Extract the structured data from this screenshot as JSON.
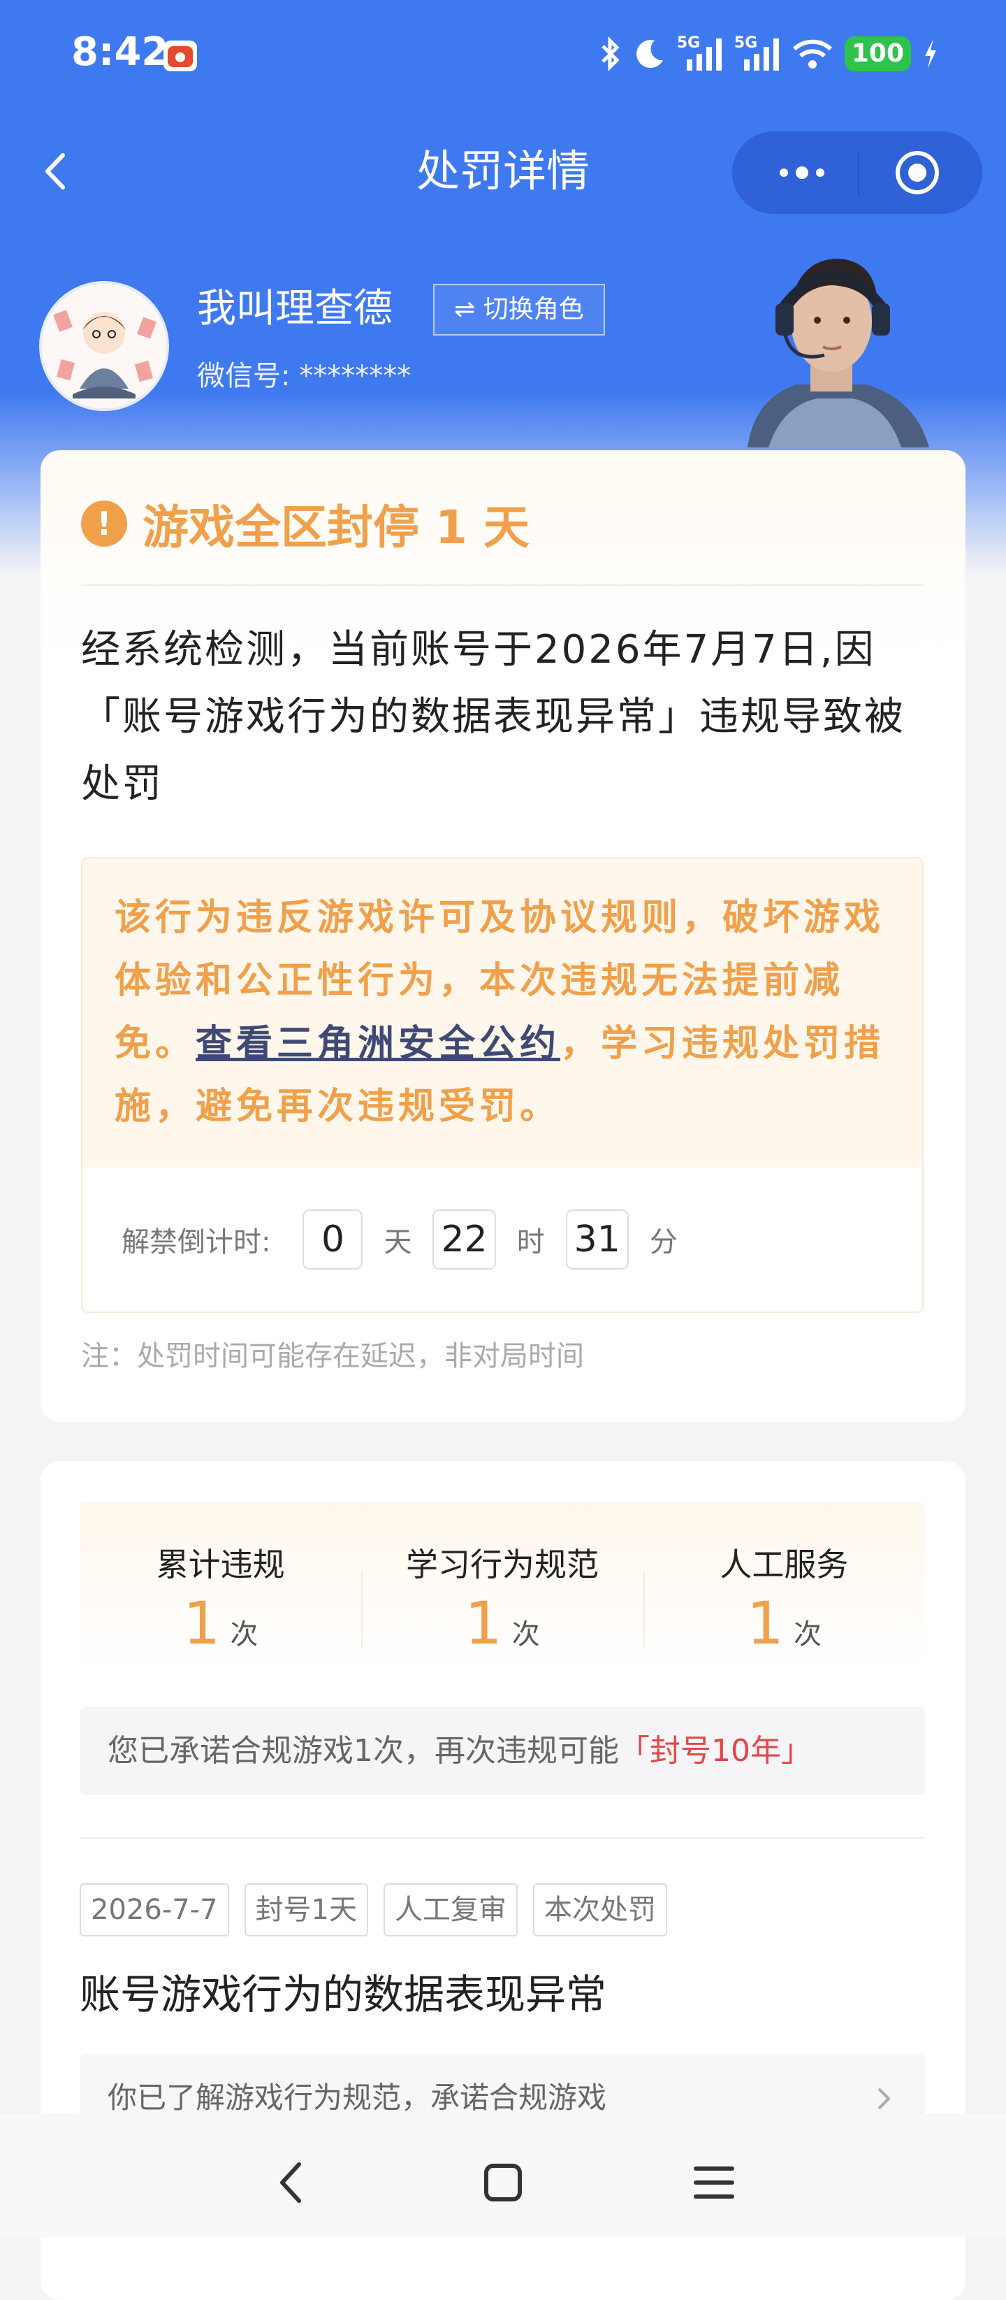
{
  "status_bar": {
    "time": "8:42",
    "signal_1": "5G",
    "signal_2": "5G",
    "battery": "100",
    "icons": [
      "notification-app-icon",
      "bluetooth-icon",
      "moon-icon",
      "signal-icon",
      "wifi-icon",
      "battery-icon",
      "charging-icon"
    ]
  },
  "title_bar": {
    "title": "处罚详情",
    "back_icon": "chevron-left-icon",
    "more_icon": "more-dots-icon",
    "close_icon": "target-close-icon"
  },
  "user": {
    "name": "我叫理查德",
    "switch_label": "⇌ 切换角色",
    "wechat_id": "微信号: ********"
  },
  "penalty": {
    "title": "游戏全区封停 1 天",
    "description": "经系统检测，当前账号于2026年7月7日,因「账号游戏行为的数据表现异常」违规导致被处罚",
    "notice_before": "该行为违反游戏许可及协议规则，破坏游戏体验和公正性行为，本次违规无法提前减免。",
    "notice_link": "查看三角洲安全公约",
    "notice_after": "，学习违规处罚措施，避免再次违规受罚。",
    "countdown_label": "解禁倒计时:",
    "days": "0",
    "day_unit": "天",
    "hours": "22",
    "hour_unit": "时",
    "minutes": "31",
    "minute_unit": "分",
    "footnote": "注：处罚时间可能存在延迟，非对局时间"
  },
  "stats": {
    "items": [
      {
        "label": "累计违规",
        "value": "1",
        "unit": "次"
      },
      {
        "label": "学习行为规范",
        "value": "1",
        "unit": "次"
      },
      {
        "label": "人工服务",
        "value": "1",
        "unit": "次"
      }
    ],
    "promise_text": "您已承诺合规游戏1次，再次违规可能",
    "promise_highlight": "「封号10年」"
  },
  "record": {
    "tags": [
      "2026-7-7",
      "封号1天",
      "人工复审",
      "本次处罚"
    ],
    "title": "账号游戏行为的数据表现异常",
    "ack_text": "你已了解游戏行为规范，承诺合规游戏"
  },
  "nav": {
    "icons": [
      "back-nav-icon",
      "home-nav-icon",
      "menu-nav-icon"
    ]
  },
  "colors": {
    "primary_blue": "#3f79f0",
    "warning_orange": "#f0a04b",
    "danger_red": "#e54545"
  }
}
